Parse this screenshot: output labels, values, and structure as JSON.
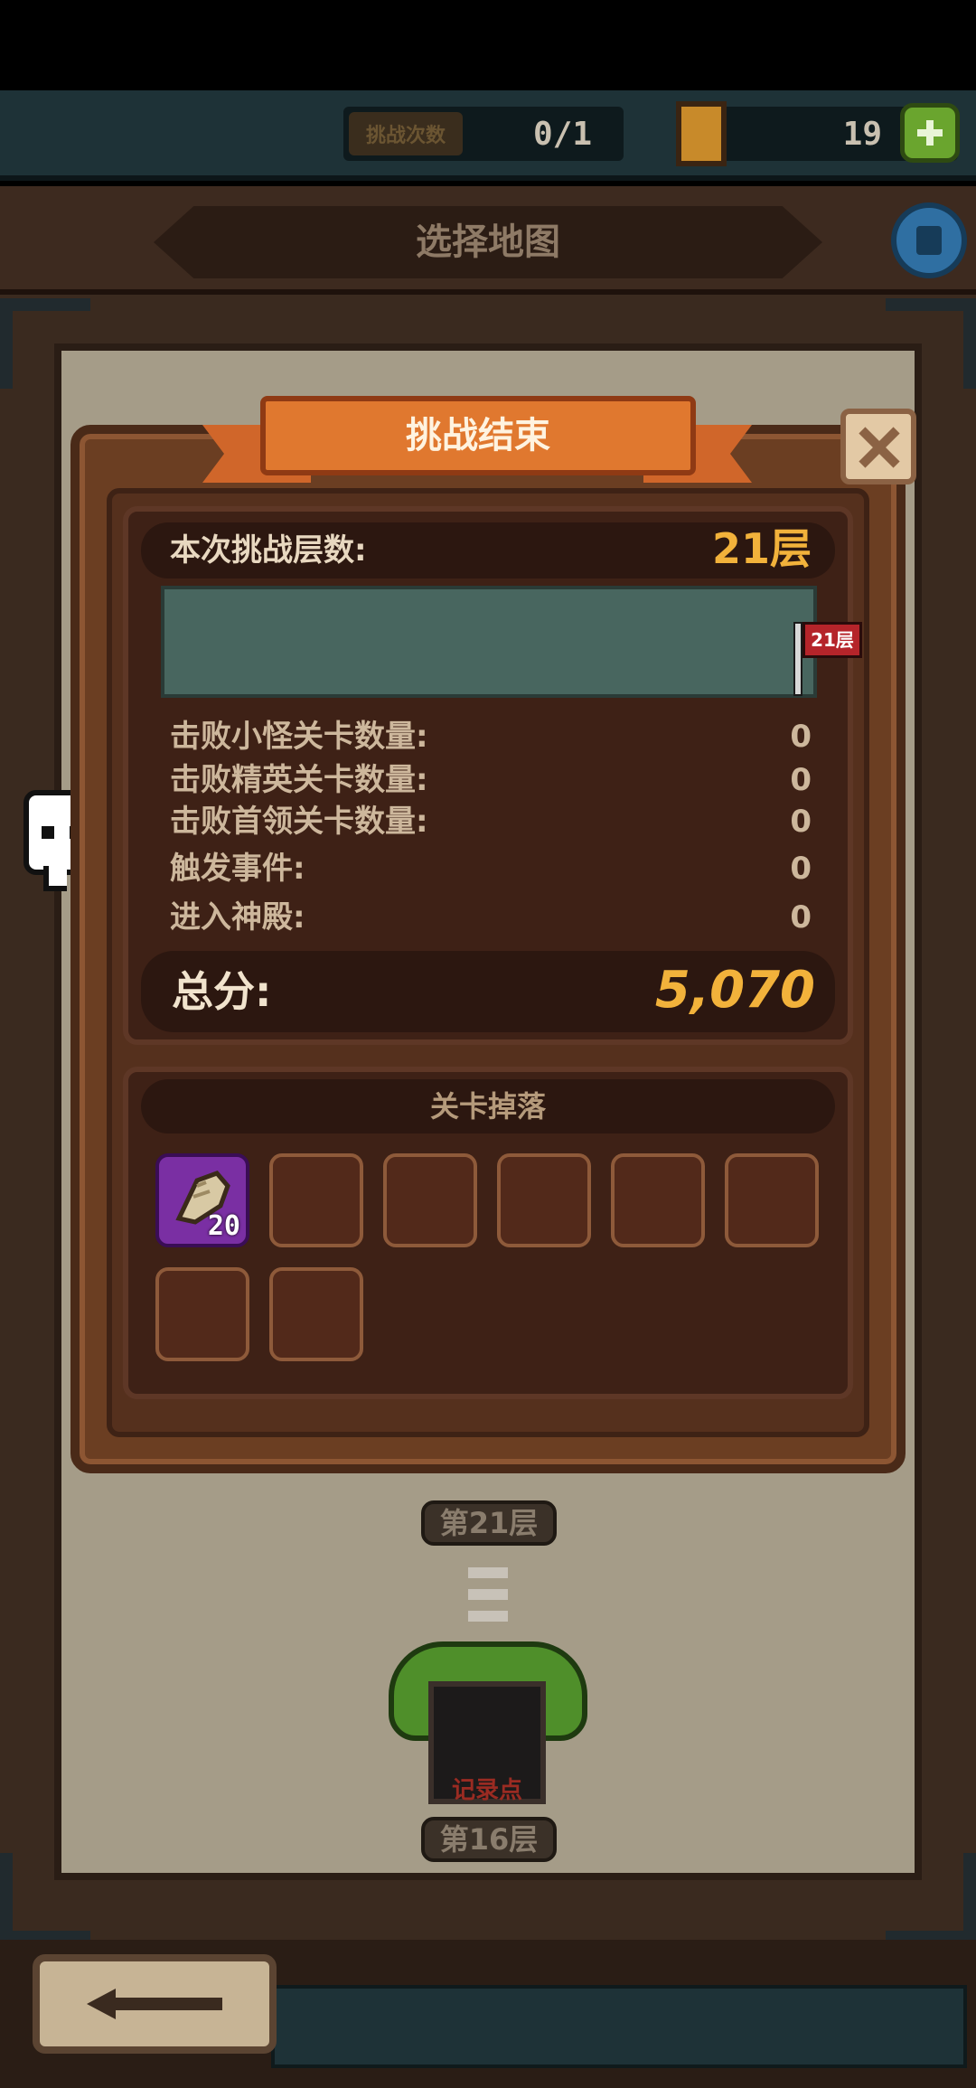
{
  "topbar": {
    "challenge_label": "挑战次数",
    "challenge_count": "0/1",
    "currency_value": "19"
  },
  "header": {
    "title": "选择地图"
  },
  "map": {
    "floor_top": "第21层",
    "floor_bottom": "第16层",
    "checkpoint_label": "记录点"
  },
  "modal": {
    "title": "挑战结束",
    "floors_label": "本次挑战层数:",
    "floors_value": "21层",
    "flag_label": "21层",
    "stats": [
      {
        "label": "击败小怪关卡数量:",
        "value": "0"
      },
      {
        "label": "击败精英关卡数量:",
        "value": "0"
      },
      {
        "label": "击败首领关卡数量:",
        "value": "0"
      },
      {
        "label": "触发事件:",
        "value": "0"
      },
      {
        "label": "进入神殿:",
        "value": "0"
      }
    ],
    "total_label": "总分:",
    "total_value": "5,070",
    "drops_title": "关卡掉落",
    "drops": [
      {
        "item": "bone-fragment-icon",
        "qty": "20"
      }
    ]
  },
  "colors": {
    "accent_orange": "#e0782f",
    "score_gold": "#f2b23b",
    "flag_red": "#b5242a",
    "rare_purple": "#7a2fa3"
  }
}
